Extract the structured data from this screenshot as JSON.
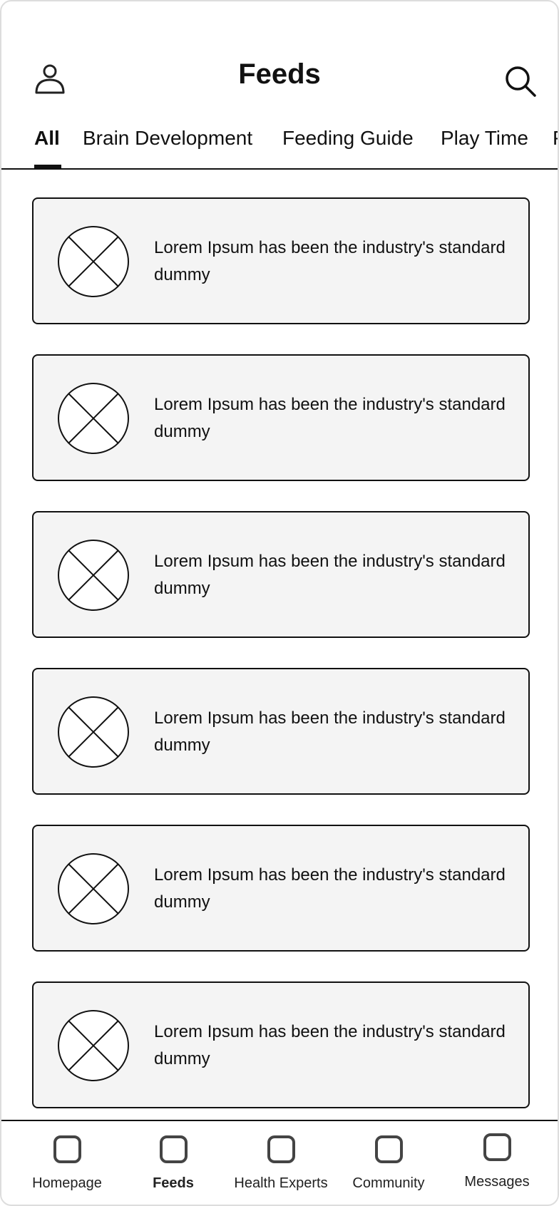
{
  "header": {
    "title": "Feeds",
    "profile_icon": "user-icon",
    "search_icon": "search-icon"
  },
  "tabs": [
    {
      "label": "All",
      "active": true
    },
    {
      "label": "Brain Development"
    },
    {
      "label": "Feeding Guide"
    },
    {
      "label": "Play Time"
    },
    {
      "label": "P"
    }
  ],
  "feed": {
    "items": [
      {
        "text": "Lorem Ipsum has been the industry's standard dummy",
        "image": "image-placeholder-icon"
      },
      {
        "text": "Lorem Ipsum has been the industry's standard dummy",
        "image": "image-placeholder-icon"
      },
      {
        "text": "Lorem Ipsum has been the industry's standard dummy",
        "image": "image-placeholder-icon"
      },
      {
        "text": "Lorem Ipsum has been the industry's standard dummy",
        "image": "image-placeholder-icon"
      },
      {
        "text": "Lorem Ipsum has been the industry's standard dummy",
        "image": "image-placeholder-icon"
      },
      {
        "text": "Lorem Ipsum has been the industry's standard dummy",
        "image": "image-placeholder-icon"
      }
    ]
  },
  "bottom_nav": {
    "items": [
      {
        "label": "Homepage"
      },
      {
        "label": "Feeds",
        "active": true
      },
      {
        "label": "Health Experts"
      },
      {
        "label": "Community"
      },
      {
        "label": "Messages"
      }
    ]
  },
  "colors": {
    "card_bg": "#f4f4f4",
    "border": "#111111",
    "icon": "#444444"
  }
}
